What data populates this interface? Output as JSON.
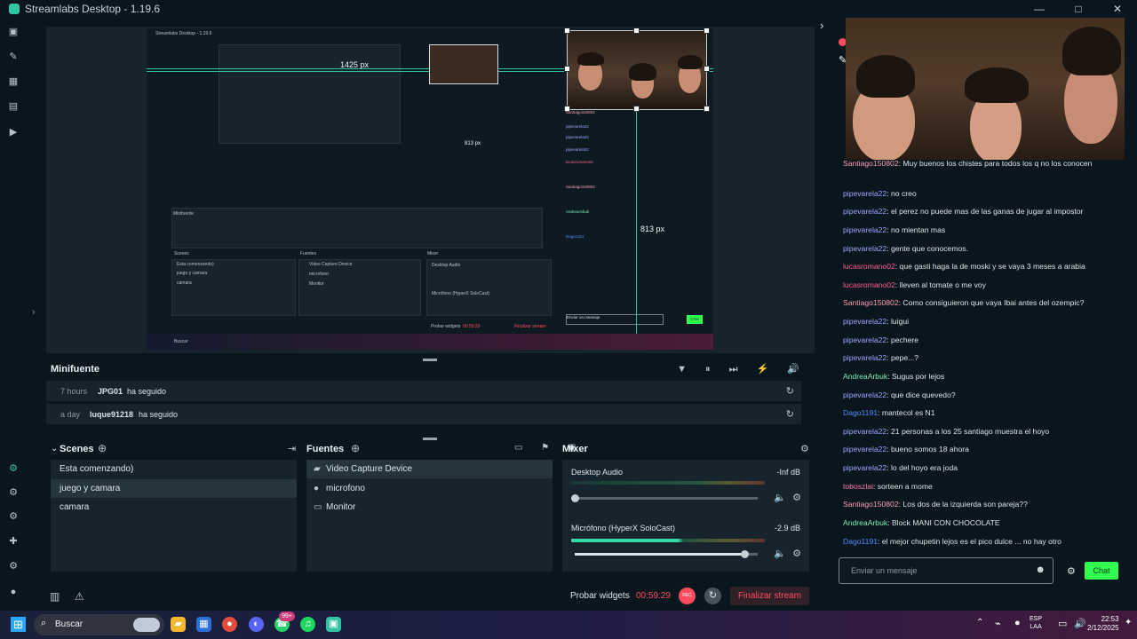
{
  "app": {
    "title": "Streamlabs Desktop - 1.19.6",
    "window_controls": [
      "—",
      "□",
      "✕"
    ]
  },
  "left_nav": {
    "icons": [
      "desktop-icon",
      "theme-icon",
      "store-icon",
      "media-icon",
      "play-icon",
      "studio-mode-icon",
      "settings-icon",
      "user-icon"
    ]
  },
  "editor": {
    "guide_labels": [
      "1425 px",
      "813 px",
      "813 px"
    ],
    "mini_app_title": "Streamlabs Desktop - 1.19.6",
    "mini_sections": [
      "Minifuente",
      "Scenes",
      "Fuentes",
      "Mixer"
    ],
    "mini_scenes": [
      "Esta comenzando)",
      "juego y camara",
      "camara"
    ],
    "mini_sources": [
      "Video Capture Device",
      "microfono",
      "Monitor"
    ],
    "mini_mixer": [
      "Desktop Audio",
      "Micrófono (HyperX SoloCast)"
    ],
    "mini_footer": [
      "Probar widgets",
      "00:59:29",
      "Finalizar stream"
    ],
    "mini_chat_placeholder": "Enviar un mensaje",
    "mini_chat_button": "Chat",
    "mini_search": "Buscar"
  },
  "minifuente": {
    "title": "Minifuente",
    "rows": [
      {
        "time": "7 hours",
        "name": "JPG01",
        "action": "ha seguido"
      },
      {
        "time": "a day",
        "name": "luque91218",
        "action": "ha seguido"
      }
    ]
  },
  "scenes": {
    "title": "Scenes",
    "items": [
      "Esta comenzando)",
      "juego y camara",
      "camara"
    ],
    "active_index": 1
  },
  "sources": {
    "title": "Fuentes",
    "items": [
      {
        "label": "Video Capture Device",
        "icon": "video-camera-icon"
      },
      {
        "label": "microfono",
        "icon": "microphone-icon"
      },
      {
        "label": "Monitor",
        "icon": "monitor-icon"
      }
    ],
    "active_index": 0
  },
  "mixer": {
    "title": "Mixer",
    "channels": [
      {
        "name": "Desktop Audio",
        "db": "-Inf dB",
        "level": 0.0
      },
      {
        "name": "Micrófono (HyperX SoloCast)",
        "db": "-2.9 dB",
        "level": 0.97
      }
    ]
  },
  "footer": {
    "widgets_label": "Probar widgets",
    "timer": "00:59:29",
    "rec_label": "REC",
    "end_label": "Finalizar stream"
  },
  "chat": {
    "messages": [
      {
        "user": "Santiago150802",
        "text": "Muy buenos los chistes para todos los q no los conocen",
        "color": "#ff9fb2"
      },
      {
        "user": "pipevarela22",
        "text": "no creo",
        "color": "#9ca8ff"
      },
      {
        "user": "pipevarela22",
        "text": "el perez no puede mas de las ganas de jugar al impostor",
        "color": "#9ca8ff"
      },
      {
        "user": "pipevarela22",
        "text": "no mientan mas",
        "color": "#9ca8ff"
      },
      {
        "user": "pipevarela22",
        "text": "gente que conocemos.",
        "color": "#9ca8ff"
      },
      {
        "user": "lucasromano02",
        "text": "que gasti haga la de moski y se vaya 3 meses a arabia",
        "color": "#ff5f8f"
      },
      {
        "user": "lucasromano02",
        "text": "lleven al tomate o me voy",
        "color": "#ff5f8f"
      },
      {
        "user": "Santiago150802",
        "text": "Como consiguieron que vaya Ibai antes del ozempic?",
        "color": "#ff9fb2"
      },
      {
        "user": "pipevarela22",
        "text": "luigui",
        "color": "#9ca8ff"
      },
      {
        "user": "pipevarela22",
        "text": "pechere",
        "color": "#9ca8ff"
      },
      {
        "user": "pipevarela22",
        "text": "pepe...?",
        "color": "#9ca8ff"
      },
      {
        "user": "AndreaArbuk",
        "text": "Sugus por lejos",
        "color": "#7bf2b8"
      },
      {
        "user": "pipevarela22",
        "text": "que dice quevedo?",
        "color": "#9ca8ff"
      },
      {
        "user": "Dago1191",
        "text": "mantecol es N1",
        "color": "#4f8cff"
      },
      {
        "user": "pipevarela22",
        "text": "21 personas a los 25 santiago muestra el hoyo",
        "color": "#9ca8ff"
      },
      {
        "user": "pipevarela22",
        "text": "bueno somos 18 ahora",
        "color": "#9ca8ff"
      },
      {
        "user": "pipevarela22",
        "text": "lo del hoyo era joda",
        "color": "#9ca8ff"
      },
      {
        "user": "toboszlai",
        "text": "sorteen a mome",
        "color": "#ff7ca2"
      },
      {
        "user": "Santiago150802",
        "text": "Los dos de la izquierda son pareja??",
        "color": "#ff9fb2"
      },
      {
        "user": "AndreaArbuk",
        "text": "Block MANI CON CHOCOLATE",
        "color": "#7bf2b8"
      },
      {
        "user": "Dago1191",
        "text": "el mejor chupetin lejos es el pico dulce ... no hay otro",
        "color": "#4f8cff"
      }
    ],
    "input_placeholder": "Enviar un mensaje",
    "send_label": "Chat"
  },
  "taskbar": {
    "search_placeholder": "Buscar",
    "notification_badge": "99+",
    "lang_top": "ESP",
    "lang_bottom": "LAA",
    "time": "22:53",
    "date": "2/12/2025"
  },
  "colors": {
    "accent": "#31c3a2",
    "danger": "#ff4d5e",
    "chat_button": "#31ff4f",
    "panel": "#17242d",
    "background": "#09161d"
  }
}
